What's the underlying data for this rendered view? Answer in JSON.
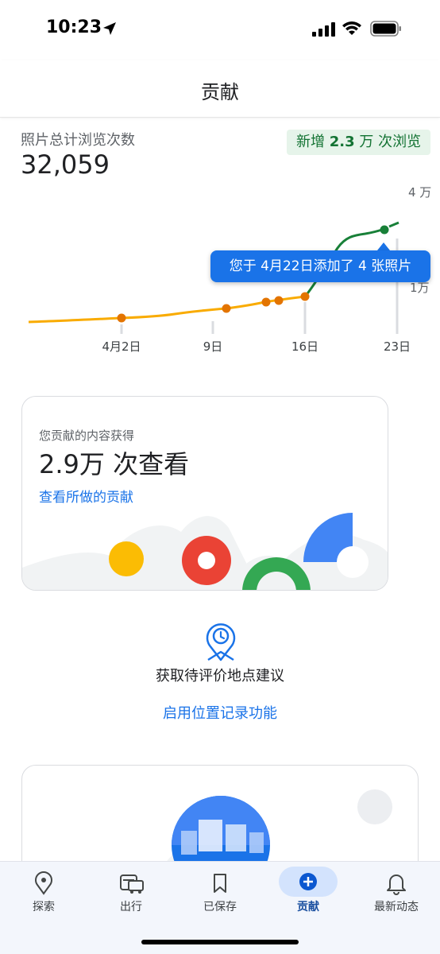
{
  "status_bar": {
    "time": "10:23"
  },
  "header": {
    "title": "贡献"
  },
  "stats": {
    "label": "照片总计浏览次数",
    "value": "32,059",
    "badge_prefix": "新增 ",
    "badge_number": "2.3",
    "badge_suffix": " 万 次浏览"
  },
  "chart_data": {
    "type": "line",
    "x_ticks": [
      "4月2日",
      "9日",
      "16日",
      "23日"
    ],
    "y_ticks": [
      "4 万",
      "1万"
    ],
    "tooltip": "您于 4月22日添加了 4 张照片",
    "series": [
      {
        "values_before": "yellow",
        "color": "#f9ab00"
      },
      {
        "values_after": "green",
        "color": "#188038"
      }
    ],
    "marker_color_orange": "#e37400",
    "marker_color_green": "#188038"
  },
  "card_views": {
    "label": "您贡献的内容获得",
    "value": "2.9万 次查看",
    "link": "查看所做的贡献"
  },
  "suggestion": {
    "title": "获取待评价地点建议",
    "link": "启用位置记录功能"
  },
  "bottom_nav": {
    "items": [
      {
        "label": "探索",
        "icon": "map-pin-icon"
      },
      {
        "label": "出行",
        "icon": "commute-icon"
      },
      {
        "label": "已保存",
        "icon": "bookmark-icon"
      },
      {
        "label": "贡献",
        "icon": "add-circle-icon"
      },
      {
        "label": "最新动态",
        "icon": "bell-icon"
      }
    ]
  },
  "colors": {
    "accent": "#1a73e8",
    "green": "#137333",
    "yellow": "#fbbc04",
    "red": "#ea4335"
  }
}
